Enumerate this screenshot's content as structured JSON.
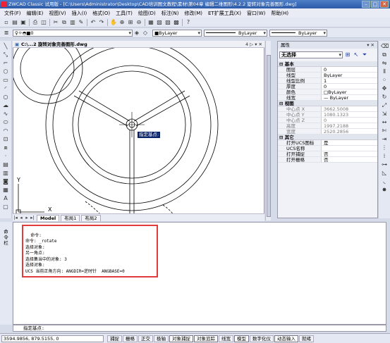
{
  "window": {
    "title": "ZWCAD Classic 试用版 - [C:\\Users\\Administrator\\Desktop\\CAD培训图文教程\\素材\\第04章 编辑二维图形\\4.2.2 旋转对象完善图形.dwg]"
  },
  "menu": [
    "文件(F)",
    "编辑(E)",
    "视图(V)",
    "插入(I)",
    "格式(O)",
    "工具(T)",
    "绘图(D)",
    "标注(N)",
    "修改(M)",
    "ET扩展工具(X)",
    "窗口(W)",
    "帮助(H)"
  ],
  "toolbar": {
    "layer_value": "0",
    "color_value": "■ByLayer",
    "linetype_value": "ByLayer",
    "lineweight_value": "ByLayer"
  },
  "drawing": {
    "tab_title": "C:\\...2 旋转对象完善图形.dwg",
    "tab_controls": "4 ▷ ▾ ✕",
    "tooltip": "指定基点:",
    "ucs_x": "X",
    "ucs_y": "Y"
  },
  "layout_tabs": [
    "Model",
    "布局1",
    "布局2"
  ],
  "properties": {
    "header": "属性",
    "pin": "▾ ✕",
    "selection": "无选择",
    "groups": [
      {
        "name": "基本",
        "rows": [
          {
            "k": "图层",
            "v": "0"
          },
          {
            "k": "线型",
            "v": "ByLayer"
          },
          {
            "k": "线型比例",
            "v": "1"
          },
          {
            "k": "厚度",
            "v": "0"
          },
          {
            "k": "颜色",
            "v": "□ByLayer"
          },
          {
            "k": "线宽",
            "v": "— ByLayer"
          }
        ]
      },
      {
        "name": "视图",
        "rows": [
          {
            "k": "中心点 X",
            "v": "3662.5008",
            "dim": true
          },
          {
            "k": "中心点 Y",
            "v": "1080.1323",
            "dim": true
          },
          {
            "k": "中心点 Z",
            "v": "0",
            "dim": true
          },
          {
            "k": "高度",
            "v": "1997.2188",
            "dim": true
          },
          {
            "k": "宽度",
            "v": "2520.2856",
            "dim": true
          }
        ]
      },
      {
        "name": "其它",
        "rows": [
          {
            "k": "打开UCS图标",
            "v": "是"
          },
          {
            "k": "UCS名称",
            "v": ""
          },
          {
            "k": "打开捕捉",
            "v": "否"
          },
          {
            "k": "打开栅格",
            "v": "否"
          }
        ]
      }
    ]
  },
  "command": {
    "side_label": "命\n令\n栏",
    "history": "命令:\n命令: _rotate\n选择对象:\n另一角点:\n选择集当中的对象: 3\n选择对象:\nUCS 当前正角方向: ANGDIR=逆时针  ANGBASE=0",
    "prompt": "指定基点:"
  },
  "status": {
    "coords": "3594.9856,  879.5155,  0",
    "buttons": [
      "捕捉",
      "栅格",
      "正交",
      "极轴",
      "对象捕捉",
      "对象追踪",
      "线宽",
      "模型",
      "数字化仪",
      "动态输入",
      "就绪"
    ]
  }
}
